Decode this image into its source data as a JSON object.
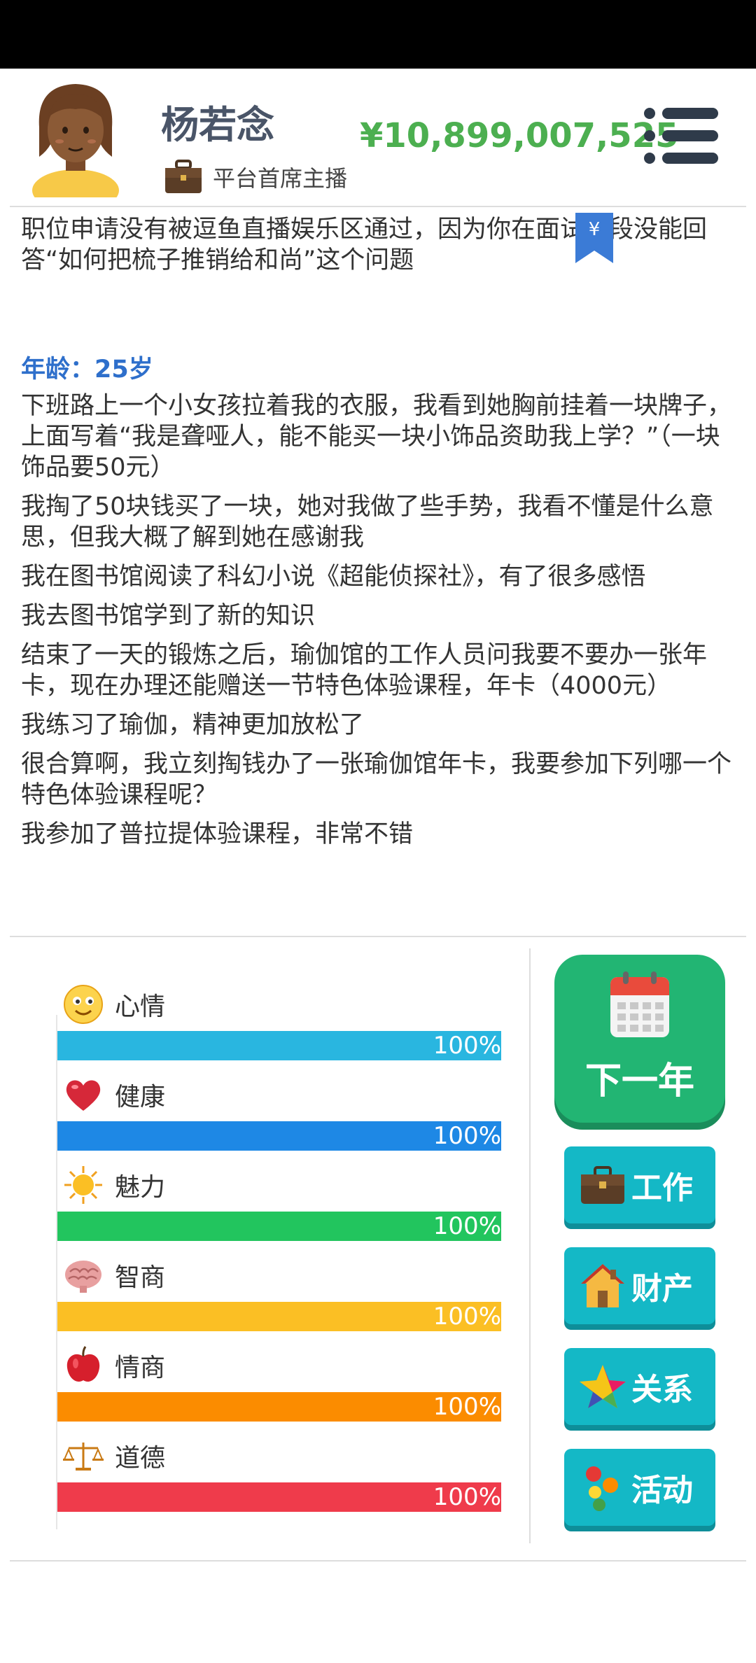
{
  "player": {
    "name": "杨若念",
    "job_title": "平台首席主播",
    "money": "¥10,899,007,525"
  },
  "bookmark_symbol": "¥",
  "log": {
    "first": "职位申请没有被逗鱼直播娱乐区通过，因为你在面试阶段没能回答“如何把梳子推销给和尚”这个问题",
    "age": "年龄：25岁",
    "entries": [
      "下班路上一个小女孩拉着我的衣服，我看到她胸前挂着一块牌子，上面写着“我是聋哑人，能不能买一块小饰品资助我上学？”（一块饰品要50元）",
      "我掏了50块钱买了一块，她对我做了些手势，我看不懂是什么意思，但我大概了解到她在感谢我",
      "我在图书馆阅读了科幻小说《超能侦探社》，有了很多感悟",
      "我去图书馆学到了新的知识",
      "结束了一天的锻炼之后，瑜伽馆的工作人员问我要不要办一张年卡，现在办理还能赠送一节特色体验课程，年卡（4000元）",
      "我练习了瑜伽，精神更加放松了",
      "很合算啊，我立刻掏钱办了一张瑜伽馆年卡，我要参加下列哪一个特色体验课程呢？",
      "我参加了普拉提体验课程，非常不错"
    ]
  },
  "stats": [
    {
      "label": "心情",
      "percent": 100,
      "text": "100%",
      "icon": "smiley-icon",
      "color": "#29b6e0"
    },
    {
      "label": "健康",
      "percent": 100,
      "text": "100%",
      "icon": "heart-icon",
      "color": "#1e88e5"
    },
    {
      "label": "魅力",
      "percent": 100,
      "text": "100%",
      "icon": "sun-icon",
      "color": "#22c55e"
    },
    {
      "label": "智商",
      "percent": 100,
      "text": "100%",
      "icon": "brain-icon",
      "color": "#fbbf24"
    },
    {
      "label": "情商",
      "percent": 100,
      "text": "100%",
      "icon": "apple-icon",
      "color": "#fb8c00"
    },
    {
      "label": "道德",
      "percent": 100,
      "text": "100%",
      "icon": "scales-icon",
      "color": "#ef3b4b"
    }
  ],
  "actions": {
    "next_year": "下一年",
    "work": "工作",
    "property": "财产",
    "relations": "关系",
    "activities": "活动"
  },
  "colors": {
    "money": "#4caf50",
    "age": "#2e6fcb",
    "next_year_bg": "#22b573",
    "action_bg": "#14b8c6"
  }
}
